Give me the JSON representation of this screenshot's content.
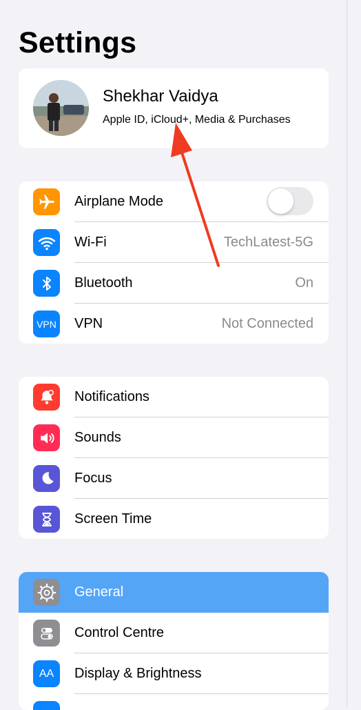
{
  "header": {
    "title": "Settings"
  },
  "profile": {
    "name": "Shekhar Vaidya",
    "subtitle": "Apple ID, iCloud+, Media & Purchases"
  },
  "group1": {
    "items": [
      {
        "label": "Airplane Mode",
        "icon": "airplane-icon",
        "color": "#ff9500",
        "control": "toggle",
        "toggle_on": false
      },
      {
        "label": "Wi-Fi",
        "icon": "wifi-icon",
        "color": "#0a84ff",
        "value": "TechLatest-5G"
      },
      {
        "label": "Bluetooth",
        "icon": "bluetooth-icon",
        "color": "#0a84ff",
        "value": "On"
      },
      {
        "label": "VPN",
        "icon": "vpn-icon",
        "icon_text": "VPN",
        "color": "#0a84ff",
        "value": "Not Connected"
      }
    ]
  },
  "group2": {
    "items": [
      {
        "label": "Notifications",
        "icon": "notifications-bell-icon",
        "color": "#ff3b30"
      },
      {
        "label": "Sounds",
        "icon": "speaker-icon",
        "color": "#ff2d55"
      },
      {
        "label": "Focus",
        "icon": "moon-icon",
        "color": "#5856d6"
      },
      {
        "label": "Screen Time",
        "icon": "hourglass-icon",
        "color": "#5856d6"
      }
    ]
  },
  "group3": {
    "items": [
      {
        "label": "General",
        "icon": "gear-icon",
        "color": "#8e8e93",
        "selected": true
      },
      {
        "label": "Control Centre",
        "icon": "toggles-icon",
        "color": "#8e8e93"
      },
      {
        "label": "Display & Brightness",
        "icon": "display-brightness-icon",
        "icon_text": "AA",
        "color": "#0a84ff"
      }
    ]
  },
  "colors": {
    "background": "#f2f2f7",
    "selection": "#55a5f7",
    "annotation_arrow": "#f03a21"
  }
}
